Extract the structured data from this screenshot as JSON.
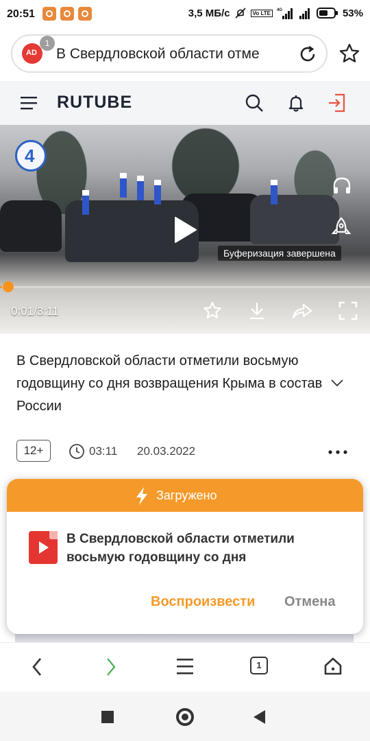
{
  "status_bar": {
    "time": "20:51",
    "network_speed": "3,5 МБ/с",
    "network_type": "4G",
    "volte": "Vo LTE",
    "battery": "53"
  },
  "browser": {
    "address_text": "В Свердловской области отме",
    "adblock_count": "1",
    "tabs_count": "1"
  },
  "rutube": {
    "logo": "RUTUBE"
  },
  "player": {
    "channel_logo": "4",
    "buffer_text": "Буферизация завершена",
    "time": "0:01/3:11",
    "progress": 0.005
  },
  "video": {
    "title": "В Свердловской области отметили восьмую годовщину со дня возвращения Крыма в состав России",
    "age_rating": "12+",
    "duration": "03:11",
    "date": "20.03.2022"
  },
  "dialog": {
    "title": "Загружено",
    "file_name": "В Свердловской области отметили восьмую годовщину со дня",
    "play_label": "Воспроизвести",
    "cancel_label": "Отмена"
  },
  "colors": {
    "accent": "#f59a2a",
    "progress": "#f7931e",
    "rutube_login": "#e8533f",
    "file_icon": "#e53530"
  }
}
